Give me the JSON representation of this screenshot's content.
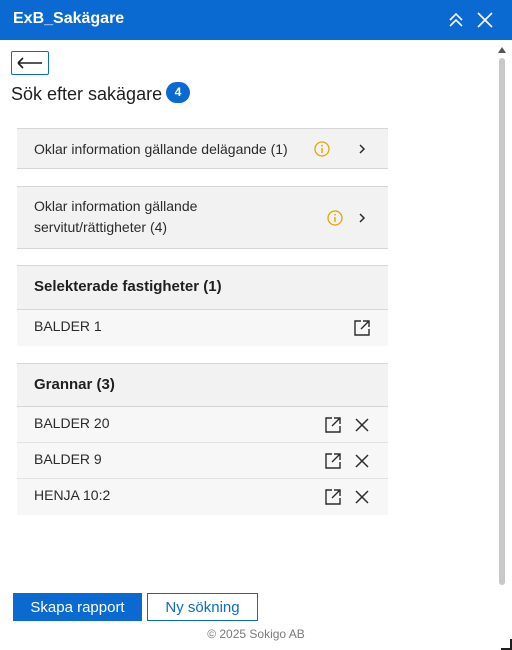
{
  "window": {
    "title": "ExB_Sakägare"
  },
  "heading": {
    "title": "Sök efter sakägare",
    "badge": "4"
  },
  "notices": [
    {
      "label": "Oklar information gällande delägande (1)"
    },
    {
      "label_line1": "Oklar information gällande",
      "label_line2": "servitut/rättigheter (4)"
    }
  ],
  "selected": {
    "title": "Selekterade fastigheter (1)",
    "rows": [
      {
        "label": "BALDER 1"
      }
    ]
  },
  "neighbors": {
    "title": "Grannar (3)",
    "rows": [
      {
        "label": "BALDER 20"
      },
      {
        "label": "BALDER 9"
      },
      {
        "label": "HENJA 10:2"
      }
    ]
  },
  "actions": {
    "create_report": "Skapa rapport",
    "new_search": "Ny sökning"
  },
  "footer": {
    "copyright": "© 2025 Sokigo AB"
  },
  "colors": {
    "accent": "#0b6ad1",
    "warning": "#e0a800"
  },
  "icons": [
    "collapse-icon",
    "close-icon",
    "back-arrow-icon",
    "info-icon",
    "chevron-right-icon",
    "open-external-icon",
    "remove-icon"
  ]
}
